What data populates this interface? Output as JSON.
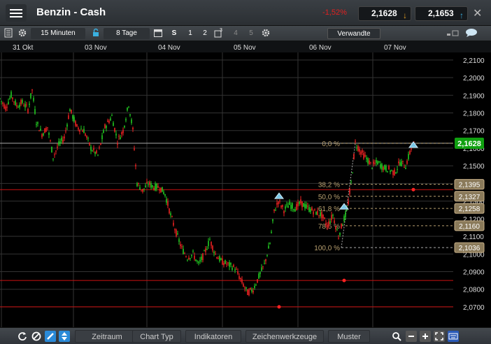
{
  "header": {
    "title": "Benzin - Cash",
    "change": "-1,52%",
    "bid": "2,1628",
    "ask": "2,1653"
  },
  "toolbar": {
    "interval": "15 Minuten",
    "range": "8 Tage",
    "s_label": "S",
    "num1": "1",
    "num2": "2",
    "num3": "3",
    "num4": "4",
    "num5": "5",
    "related": "Verwandte"
  },
  "bottom": {
    "tabs": [
      "Zeitraum",
      "Chart Typ",
      "Indikatoren",
      "Zeichenwerkzeuge",
      "Muster"
    ]
  },
  "colors": {
    "up": "#22cc22",
    "down": "#ee2222",
    "fib": "#b8a070",
    "hline": "#cc1111",
    "grid": "#333"
  },
  "chart_data": {
    "type": "candlestick",
    "x_labels": [
      "31 Okt",
      "03 Nov",
      "04 Nov",
      "05 Nov",
      "06 Nov",
      "07 Nov"
    ],
    "y_ticks": [
      "2,1000",
      "2,0900",
      "2,0800",
      "2,0700",
      "2,1100",
      "2,1200",
      "2,1300",
      "2,1400",
      "2,1500",
      "2,1600",
      "2,1700",
      "2,1800",
      "2,1900",
      "2,2000",
      "2,2100"
    ],
    "y_range": [
      2.066,
      2.2135
    ],
    "last_price": "2,1628",
    "fibonacci": [
      {
        "label": "0,0 %",
        "value": 2.1628,
        "tag": ""
      },
      {
        "label": "38,2 %",
        "value": 2.1395,
        "tag": "2,1395"
      },
      {
        "label": "50,0 %",
        "value": 2.1327,
        "tag": "2,1327"
      },
      {
        "label": "61,8 %",
        "value": 2.1258,
        "tag": "2,1258"
      },
      {
        "label": "78,6 %",
        "value": 2.116,
        "tag": "2,1160"
      },
      {
        "label": "100,0 %",
        "value": 2.1036,
        "tag": "2,1036"
      }
    ],
    "horizontal_lines": [
      2.1628,
      2.1365,
      2.085,
      2.07
    ],
    "path": [
      [
        0,
        2.188
      ],
      [
        8,
        2.183
      ],
      [
        16,
        2.19
      ],
      [
        24,
        2.184
      ],
      [
        32,
        2.186
      ],
      [
        40,
        2.182
      ],
      [
        46,
        2.193
      ],
      [
        52,
        2.175
      ],
      [
        60,
        2.168
      ],
      [
        68,
        2.172
      ],
      [
        76,
        2.155
      ],
      [
        84,
        2.162
      ],
      [
        92,
        2.166
      ],
      [
        100,
        2.182
      ],
      [
        110,
        2.172
      ],
      [
        120,
        2.17
      ],
      [
        130,
        2.16
      ],
      [
        140,
        2.156
      ],
      [
        150,
        2.172
      ],
      [
        160,
        2.178
      ],
      [
        168,
        2.164
      ],
      [
        176,
        2.17
      ],
      [
        184,
        2.185
      ],
      [
        190,
        2.17
      ],
      [
        196,
        2.14
      ],
      [
        204,
        2.136
      ],
      [
        212,
        2.14
      ],
      [
        220,
        2.138
      ],
      [
        228,
        2.138
      ],
      [
        236,
        2.134
      ],
      [
        244,
        2.122
      ],
      [
        252,
        2.112
      ],
      [
        260,
        2.103
      ],
      [
        268,
        2.098
      ],
      [
        276,
        2.1
      ],
      [
        284,
        2.094
      ],
      [
        292,
        2.1
      ],
      [
        300,
        2.108
      ],
      [
        308,
        2.1
      ],
      [
        316,
        2.096
      ],
      [
        326,
        2.094
      ],
      [
        336,
        2.092
      ],
      [
        346,
        2.084
      ],
      [
        354,
        2.078
      ],
      [
        362,
        2.08
      ],
      [
        370,
        2.087
      ],
      [
        378,
        2.094
      ],
      [
        386,
        2.106
      ],
      [
        392,
        2.124
      ],
      [
        398,
        2.13
      ],
      [
        406,
        2.125
      ],
      [
        414,
        2.128
      ],
      [
        422,
        2.126
      ],
      [
        430,
        2.129
      ],
      [
        440,
        2.126
      ],
      [
        450,
        2.124
      ],
      [
        460,
        2.122
      ],
      [
        468,
        2.116
      ],
      [
        476,
        2.122
      ],
      [
        484,
        2.11
      ],
      [
        490,
        2.118
      ],
      [
        496,
        2.124
      ],
      [
        502,
        2.14
      ],
      [
        508,
        2.163
      ],
      [
        516,
        2.158
      ],
      [
        524,
        2.154
      ],
      [
        532,
        2.15
      ],
      [
        540,
        2.152
      ],
      [
        548,
        2.149
      ],
      [
        556,
        2.148
      ],
      [
        564,
        2.146
      ],
      [
        572,
        2.152
      ],
      [
        580,
        2.15
      ],
      [
        588,
        2.16
      ],
      [
        594,
        2.162
      ]
    ]
  }
}
